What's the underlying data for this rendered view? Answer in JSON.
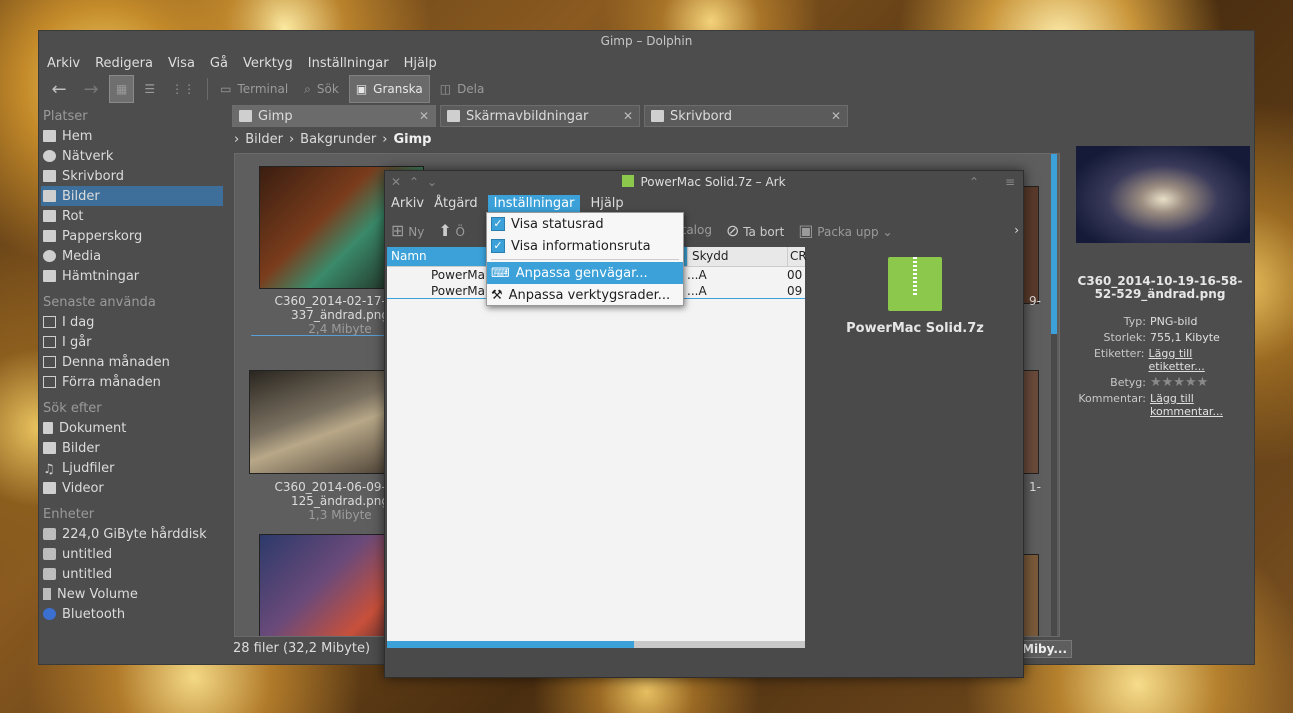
{
  "window": {
    "title": "Gimp – Dolphin"
  },
  "menu": [
    "Arkiv",
    "Redigera",
    "Visa",
    "Gå",
    "Verktyg",
    "Inställningar",
    "Hjälp"
  ],
  "toolbar": {
    "terminal": "Terminal",
    "search": "Sök",
    "preview": "Granska",
    "split": "Dela"
  },
  "sidebar": {
    "places_title": "Platser",
    "places": [
      "Hem",
      "Nätverk",
      "Skrivbord",
      "Bilder",
      "Rot",
      "Papperskorg",
      "Media",
      "Hämtningar"
    ],
    "recent_title": "Senaste använda",
    "recent": [
      "I dag",
      "I går",
      "Denna månaden",
      "Förra månaden"
    ],
    "search_title": "Sök efter",
    "search": [
      "Dokument",
      "Bilder",
      "Ljudfiler",
      "Videor"
    ],
    "devices_title": "Enheter",
    "devices": [
      "224,0 GiByte hårddisk",
      "untitled",
      "untitled",
      "New Volume",
      "Bluetooth"
    ]
  },
  "tabs": [
    {
      "label": "Gimp"
    },
    {
      "label": "Skärmavbildningar"
    },
    {
      "label": "Skrivbord"
    }
  ],
  "breadcrumb": [
    "Bilder",
    "Bakgrunder",
    "Gimp"
  ],
  "files": [
    {
      "name1": "C360_2014-02-17-10-",
      "name2": "337_ändrad.png",
      "size": "2,4 Mibyte"
    },
    {
      "name1": "C360_2014-06-09-18-",
      "name2": "125_ändrad.png",
      "size": "1,3 Mibyte"
    }
  ],
  "right_fragments": [
    "9-",
    "1-"
  ],
  "status": "28 filer (32,2 Mibyte)",
  "zoom_label": "Miby...",
  "info": {
    "filename": "C360_2014-10-19-16-58-52-529_ändrad.png",
    "type_k": "Typ:",
    "type_v": "PNG-bild",
    "size_k": "Storlek:",
    "size_v": "755,1 Kibyte",
    "tags_k": "Etiketter:",
    "tags_v": "Lägg till etiketter...",
    "rating_k": "Betyg:",
    "rating_v": "★★★★★",
    "comment_k": "Kommentar:",
    "comment_v": "Lägg till kommentar..."
  },
  "ark": {
    "title": "PowerMac Solid.7z – Ark",
    "menu": [
      "Arkiv",
      "Åtgärd",
      "Inställningar",
      "Hjälp"
    ],
    "tb": {
      "new": "Ny",
      "open": "Ö",
      "extract_dir": "till katalog",
      "delete": "Ta bort",
      "extract": "Packa upp"
    },
    "cols": [
      "Namn",
      "Skydd",
      "CR"
    ],
    "rows": [
      {
        "name": "PowerMa",
        "prot": "...A",
        "crc": "00"
      },
      {
        "name": "PowerMa",
        "prot": "...A",
        "crc": "09"
      }
    ],
    "archive": "PowerMac Solid.7z",
    "progress": 0.59
  },
  "dropdown": [
    "Visa statusrad",
    "Visa informationsruta",
    "Anpassa genvägar...",
    "Anpassa verktygsrader..."
  ]
}
